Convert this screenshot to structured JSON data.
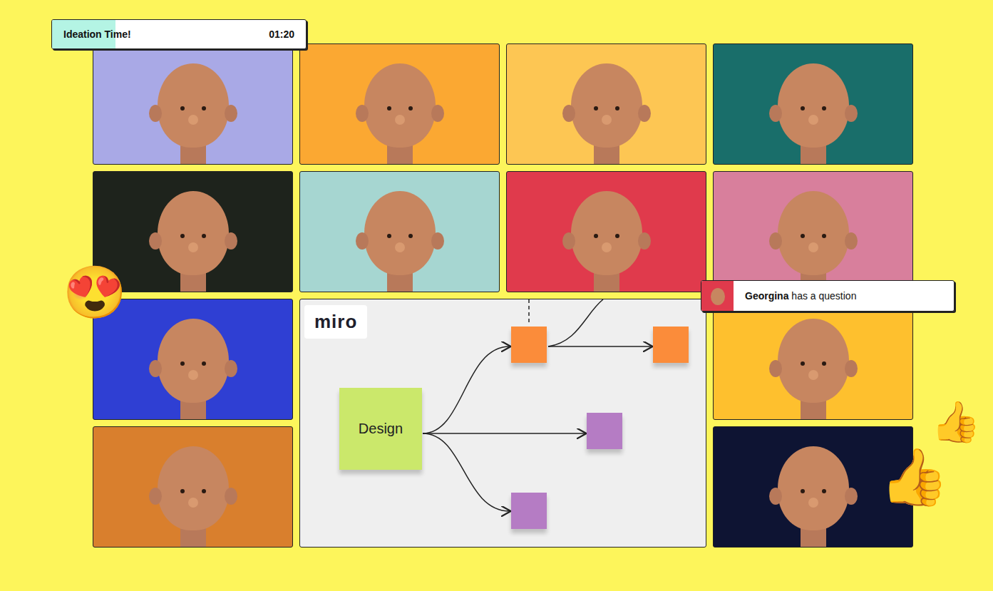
{
  "timer": {
    "label": "Ideation Time!",
    "time": "01:20",
    "level": 0.25
  },
  "participants": [
    {
      "color": "#a9a9e6"
    },
    {
      "color": "#fba832"
    },
    {
      "color": "#fdc653"
    },
    {
      "color": "#196e6a"
    },
    {
      "color": "#1e231c"
    },
    {
      "color": "#a6d6d1"
    },
    {
      "color": "#e03a4c"
    },
    {
      "color": "#d87f9c"
    },
    {
      "color": "#2f3fd3"
    },
    {
      "color": "#fec02e"
    },
    {
      "color": "#d97f2d"
    },
    {
      "color": "#0e1433"
    }
  ],
  "notification": {
    "name": "Georgina",
    "text": "has a question"
  },
  "reactions": [
    "😍",
    "👍",
    "👍"
  ],
  "board": {
    "logo": "miro",
    "root": {
      "label": "Design"
    },
    "notes": [
      {
        "color": "#fb8c3a"
      },
      {
        "color": "#fb8c3a"
      },
      {
        "color": "#b57cc4"
      },
      {
        "color": "#b57cc4"
      }
    ]
  }
}
